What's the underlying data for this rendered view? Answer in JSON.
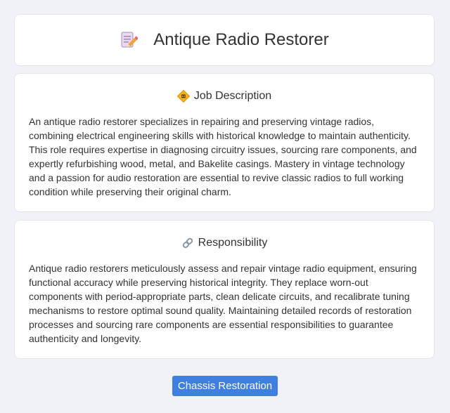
{
  "header": {
    "title": "Antique Radio Restorer",
    "icon": "memo-pencil-icon"
  },
  "sections": [
    {
      "title": "Job Description",
      "icon": "radio-diamond-icon",
      "body": "An antique radio restorer specializes in repairing and preserving vintage radios, combining electrical engineering skills with historical knowledge to maintain authenticity. This role requires expertise in diagnosing circuitry issues, sourcing rare components, and expertly refurbishing wood, metal, and Bakelite casings. Mastery in vintage technology and a passion for audio restoration are essential to revive classic radios to full working condition while preserving their original charm."
    },
    {
      "title": "Responsibility",
      "icon": "link-icon",
      "body": "Antique radio restorers meticulously assess and repair vintage radio equipment, ensuring functional accuracy while preserving historical integrity. They replace worn-out components with period-appropriate parts, clean delicate circuits, and recalibrate tuning mechanisms to restore optimal sound quality. Maintaining detailed records of restoration processes and sourcing rare components are essential responsibilities to guarantee authenticity and longevity."
    }
  ],
  "tag": {
    "label": "Chassis Restoration"
  },
  "colors": {
    "background": "#f0f2f7",
    "card": "#ffffff",
    "accent": "#3f7fe0",
    "text": "#333333"
  }
}
